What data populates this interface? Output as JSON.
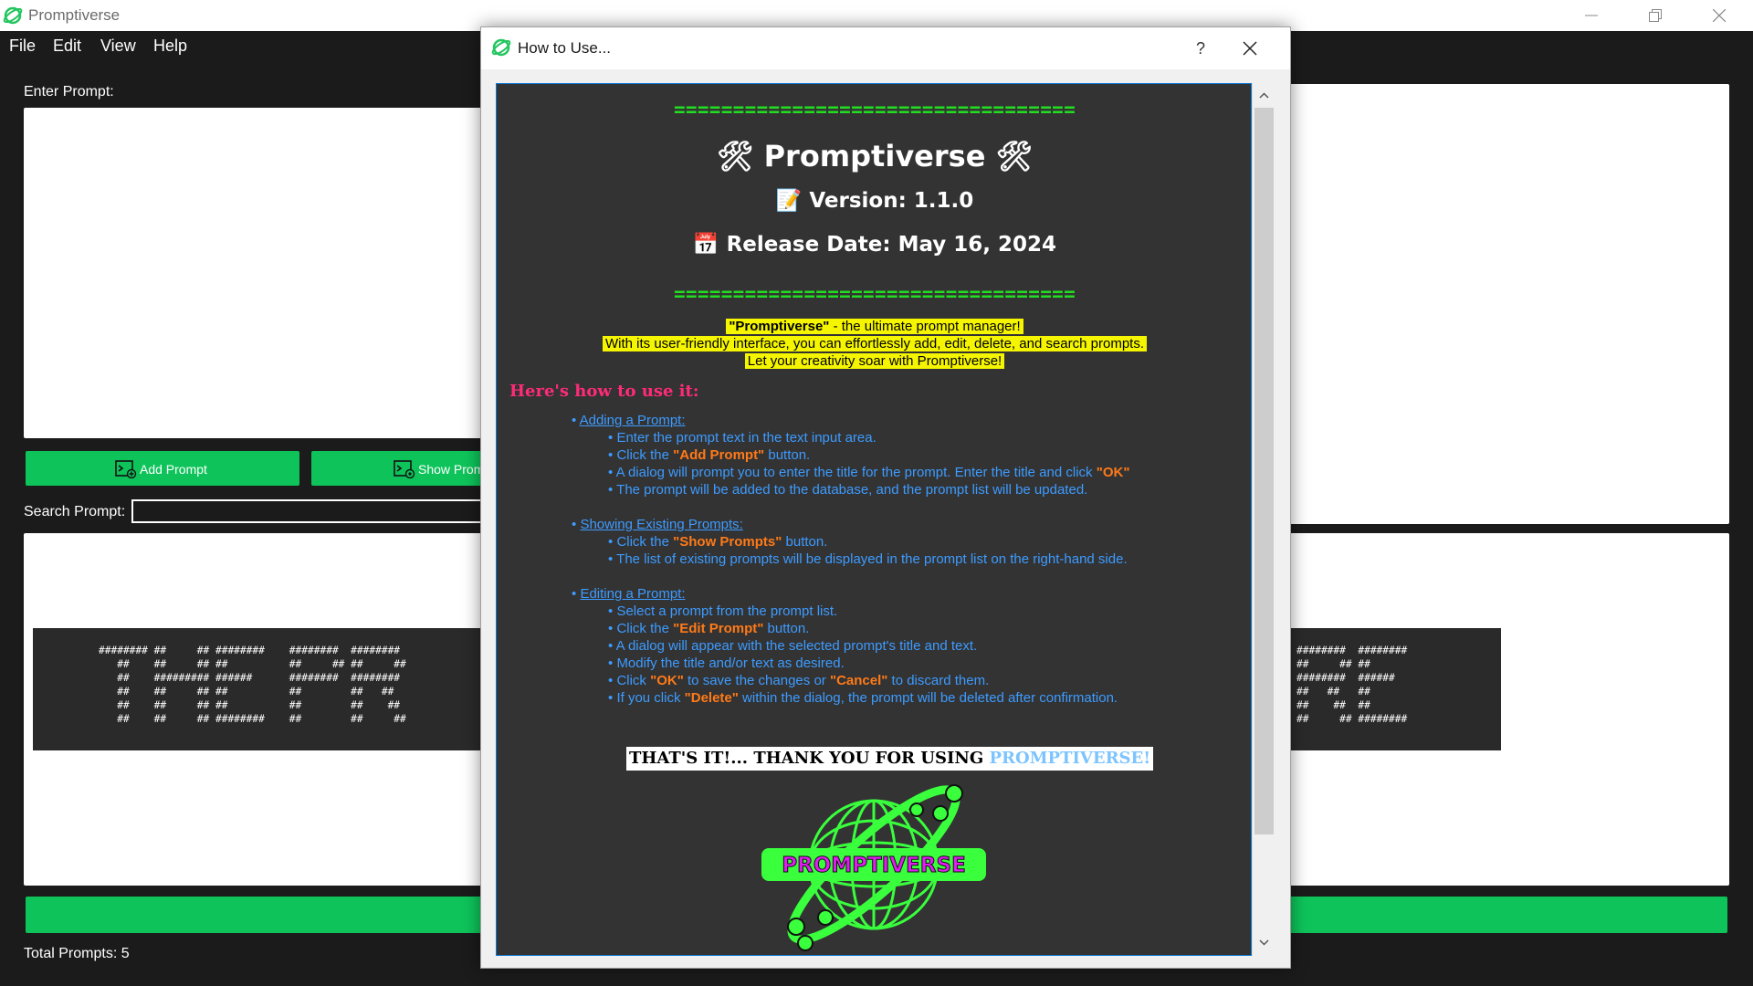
{
  "app": {
    "title": "Promptiverse",
    "menu": [
      "File",
      "Edit",
      "View",
      "Help"
    ]
  },
  "main": {
    "enter_prompt_label": "Enter Prompt:",
    "add_prompt_button": "Add Prompt",
    "show_prompts_button": "Show Prompts",
    "search_label": "Search Prompt:",
    "search_value": "",
    "total_prompts": "Total Prompts: 5",
    "banner_left": "######## ##     ## ########    ########  ########   \n   ##    ##     ## ##          ##     ## ##     ##  \n   ##    ######### ######      ########  ########   \n   ##    ##     ## ##          ##        ##   ##    \n   ##    ##     ## ##          ##        ##    ##   \n   ##    ##     ## ########    ##        ##     ##  ",
    "banner_right": "########  ########\n##     ## ##      \n########  ######  \n##   ##   ##      \n##    ##  ##      \n##     ## ########"
  },
  "dialog": {
    "title": "How to Use...",
    "help": "?",
    "separator": "==================================",
    "app_name": "Promptiverse",
    "app_emoji": "🛠",
    "version_emoji": "📝",
    "version": "Version: 1.1.0",
    "release_emoji": "📅",
    "release": "Release Date: May 16, 2024",
    "intro_brand": "\"Promptiverse\"",
    "intro_line1_rest": " - the ultimate prompt manager!",
    "intro_line2": "With its user-friendly interface, you can effortlessly add, edit, delete, and search prompts.",
    "intro_line3": "Let your creativity soar with Promptiverse!",
    "howto_title": "Here's how to use it:",
    "bullet": "•",
    "sections": [
      {
        "title": "Adding a Prompt:",
        "lines": [
          {
            "pre": "Enter the prompt text in the text input area.",
            "hl": "",
            "post": "",
            "hl2": "",
            "post2": ""
          },
          {
            "pre": "Click the ",
            "hl": "\"Add Prompt\"",
            "post": " button.",
            "hl2": "",
            "post2": ""
          },
          {
            "pre": "A dialog will prompt you to enter the title for the prompt. Enter the title and click ",
            "hl": "\"OK\"",
            "post": "",
            "hl2": "",
            "post2": ""
          },
          {
            "pre": "The prompt will be added to the database, and the prompt list will be updated.",
            "hl": "",
            "post": "",
            "hl2": "",
            "post2": ""
          }
        ]
      },
      {
        "title": "Showing Existing Prompts:",
        "lines": [
          {
            "pre": "Click the ",
            "hl": "\"Show Prompts\"",
            "post": " button.",
            "hl2": "",
            "post2": ""
          },
          {
            "pre": "The list of existing prompts will be displayed in the prompt list on the right-hand side.",
            "hl": "",
            "post": "",
            "hl2": "",
            "post2": ""
          }
        ]
      },
      {
        "title": "Editing a Prompt:",
        "lines": [
          {
            "pre": "Select a prompt from the prompt list.",
            "hl": "",
            "post": "",
            "hl2": "",
            "post2": ""
          },
          {
            "pre": "Click the ",
            "hl": "\"Edit Prompt\"",
            "post": " button.",
            "hl2": "",
            "post2": ""
          },
          {
            "pre": "A dialog will appear with the selected prompt's title and text.",
            "hl": "",
            "post": "",
            "hl2": "",
            "post2": ""
          },
          {
            "pre": "Modify the title and/or text as desired.",
            "hl": "",
            "post": "",
            "hl2": "",
            "post2": ""
          },
          {
            "pre": "Click ",
            "hl": "\"OK\"",
            "post": " to save the changes or ",
            "hl2": "\"Cancel\"",
            "post2": " to discard them."
          },
          {
            "pre": "If you click ",
            "hl": "\"Delete\"",
            "post": " within the dialog, the prompt will be deleted after confirmation.",
            "hl2": "",
            "post2": ""
          }
        ]
      }
    ],
    "thanks_text": "THAT'S IT!... THANK YOU FOR USING ",
    "thanks_brand": "PROMPTIVERSE!",
    "logo_text": "PROMPTIVERSE"
  },
  "colors": {
    "accent_green": "#0ec45a",
    "separator_green": "#22dd22",
    "link_blue": "#3d9bff",
    "highlight_orange": "#ff7a18",
    "heading_pink": "#ff2b78",
    "intro_yellow": "#f5f500",
    "logo_neon": "#39ff3c",
    "logo_magenta": "#e01cf0"
  },
  "icons": [
    "app-globe-icon",
    "minimize-icon",
    "restore-icon",
    "close-icon",
    "terminal-add-icon",
    "terminal-show-icon",
    "tools-icon",
    "memo-icon",
    "calendar-icon",
    "scroll-up-icon",
    "scroll-down-icon"
  ]
}
